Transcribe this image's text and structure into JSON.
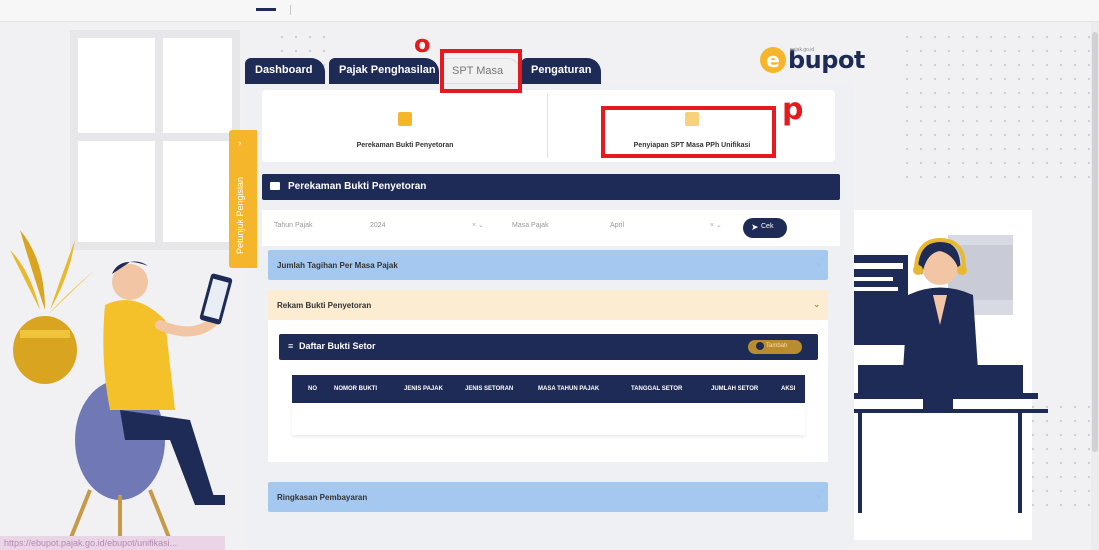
{
  "status_url": "https://ebupot.pajak.go.id/ebupot/unifikasi...",
  "tabs": {
    "dashboard": "Dashboard",
    "pajak_penghasilan": "Pajak Penghasilan",
    "spt_masa": "SPT Masa",
    "pengaturan": "Pengaturan"
  },
  "logo": {
    "e": "e",
    "word": "bupot",
    "tag": "pajak.go.id"
  },
  "side_tab": {
    "label": "Petunjuk Pengisian",
    "chevron": "›"
  },
  "menu_cards": {
    "perekaman": "Perekaman Bukti Penyetoran",
    "penyiapan": "Penyiapan SPT Masa PPh Unifikasi"
  },
  "section_title": "Perekaman Bukti Penyetoran",
  "filters": {
    "tahun_label": "Tahun Pajak",
    "tahun_value": "2024",
    "masa_label": "Masa Pajak",
    "masa_value": "April",
    "select_marks": "× ⌄",
    "cek_label": "Cek",
    "cek_icon": "paper-plane-icon"
  },
  "accordions": {
    "jumlah": "Jumlah Tagihan Per Masa Pajak",
    "rekam": "Rekam Bukti Penyetoran",
    "ringkasan": "Ringkasan Pembayaran",
    "arrow_right": "›",
    "arrow_down": "⌄"
  },
  "daftar": {
    "title": "Daftar Bukti Setor",
    "tambah": "Tambah",
    "columns": [
      "NO",
      "NOMOR BUKTI",
      "JENIS PAJAK",
      "JENIS SETORAN",
      "MASA TAHUN PAJAK",
      "TANGGAL SETOR",
      "JUMLAH SETOR",
      "AKSI"
    ]
  },
  "annotations": {
    "o": "o",
    "p": "p"
  },
  "colors": {
    "navy": "#1f2b57",
    "accent_yellow": "#f5b62b",
    "annotation_red": "#e5191e",
    "accordion_blue": "#a4c8f0",
    "accordion_cream": "#fbecd2"
  }
}
